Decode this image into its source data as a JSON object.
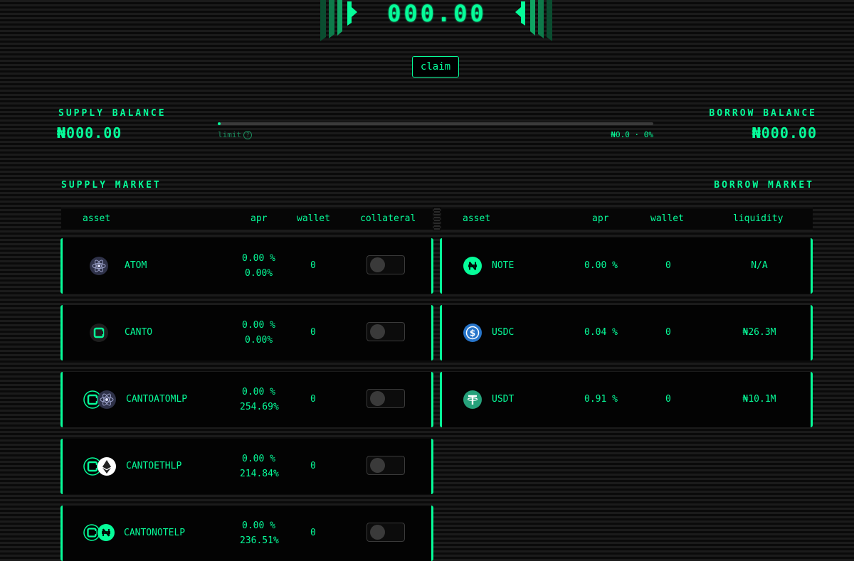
{
  "reward": {
    "value": "000.00"
  },
  "claim_label": "claim",
  "balances": {
    "supply_title": "SUPPLY BALANCE",
    "supply_value": "₦000.00",
    "borrow_title": "BORROW BALANCE",
    "borrow_value": "₦000.00",
    "limit_label": "limit",
    "limit_help": "?",
    "limit_value": "₦0.0 · 0%",
    "limit_fraction": 0.0
  },
  "supply_market": {
    "title": "SUPPLY MARKET",
    "columns": [
      "asset",
      "apr",
      "wallet",
      "collateral"
    ],
    "rows": [
      {
        "asset": "ATOM",
        "apr": "0.00 %",
        "apr_sub": "0.00%",
        "wallet": "0",
        "collateral": false,
        "icon": "atom-icon"
      },
      {
        "asset": "CANTO",
        "apr": "0.00 %",
        "apr_sub": "0.00%",
        "wallet": "0",
        "collateral": false,
        "icon": "canto-icon"
      },
      {
        "asset": "CANTOATOMLP",
        "apr": "0.00 %",
        "apr_sub": "254.69%",
        "wallet": "0",
        "collateral": false,
        "icon": "canto-atom-lp-icon"
      },
      {
        "asset": "CANTOETHLP",
        "apr": "0.00 %",
        "apr_sub": "214.84%",
        "wallet": "0",
        "collateral": false,
        "icon": "canto-eth-lp-icon"
      },
      {
        "asset": "CANTONOTELP",
        "apr": "0.00 %",
        "apr_sub": "236.51%",
        "wallet": "0",
        "collateral": false,
        "icon": "canto-note-lp-icon"
      }
    ]
  },
  "borrow_market": {
    "title": "BORROW MARKET",
    "columns": [
      "asset",
      "apr",
      "wallet",
      "liquidity"
    ],
    "rows": [
      {
        "asset": "NOTE",
        "apr": "0.00 %",
        "wallet": "0",
        "liquidity": "N/A",
        "icon": "note-icon"
      },
      {
        "asset": "USDC",
        "apr": "0.04 %",
        "wallet": "0",
        "liquidity": "₦26.3M",
        "icon": "usdc-icon"
      },
      {
        "asset": "USDT",
        "apr": "0.91 %",
        "wallet": "0",
        "liquidity": "₦10.1M",
        "icon": "usdt-icon"
      }
    ]
  },
  "colors": {
    "accent": "#06fc99",
    "accent_dim": "#1a8a5c",
    "background": "#0d0d0d"
  }
}
